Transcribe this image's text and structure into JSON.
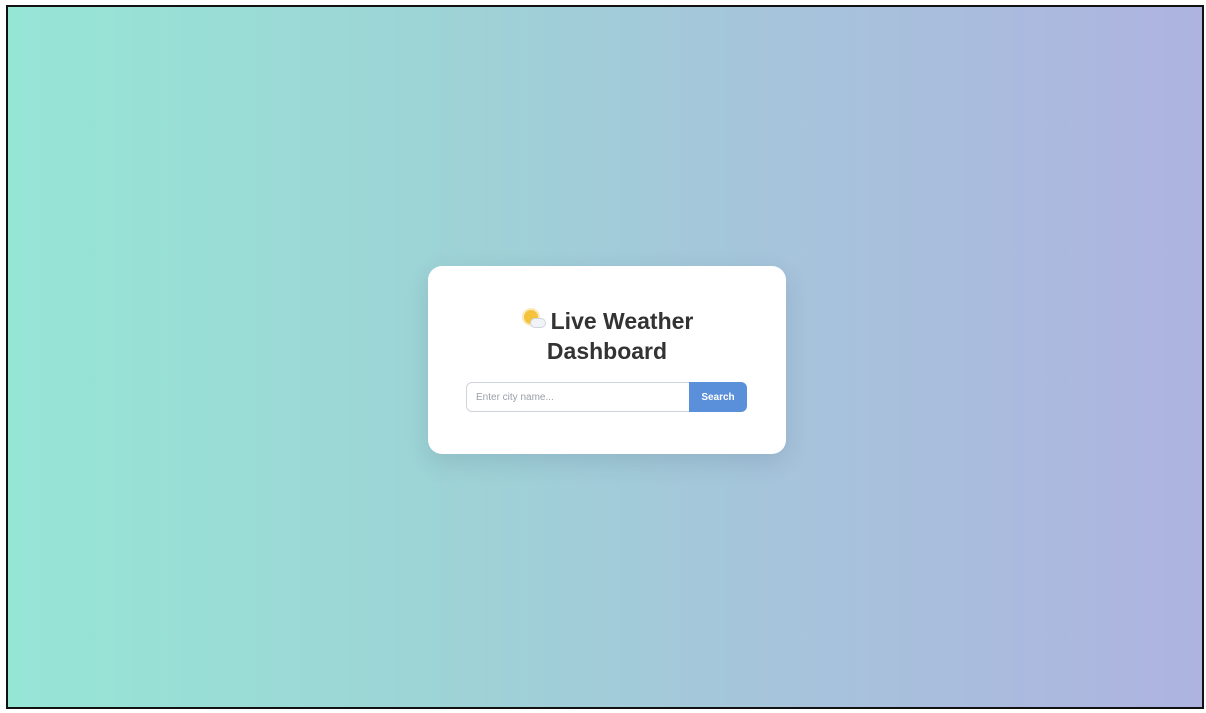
{
  "app": {
    "title_line1": "Live Weather",
    "title_line2": "Dashboard",
    "title_icon": "sun-behind-cloud-icon"
  },
  "search": {
    "placeholder": "Enter city name...",
    "value": "",
    "button_label": "Search"
  },
  "colors": {
    "gradient_start": "#96e6d6",
    "gradient_end": "#aeb3e0",
    "button": "#5a8fd9",
    "title_text": "#333333"
  }
}
